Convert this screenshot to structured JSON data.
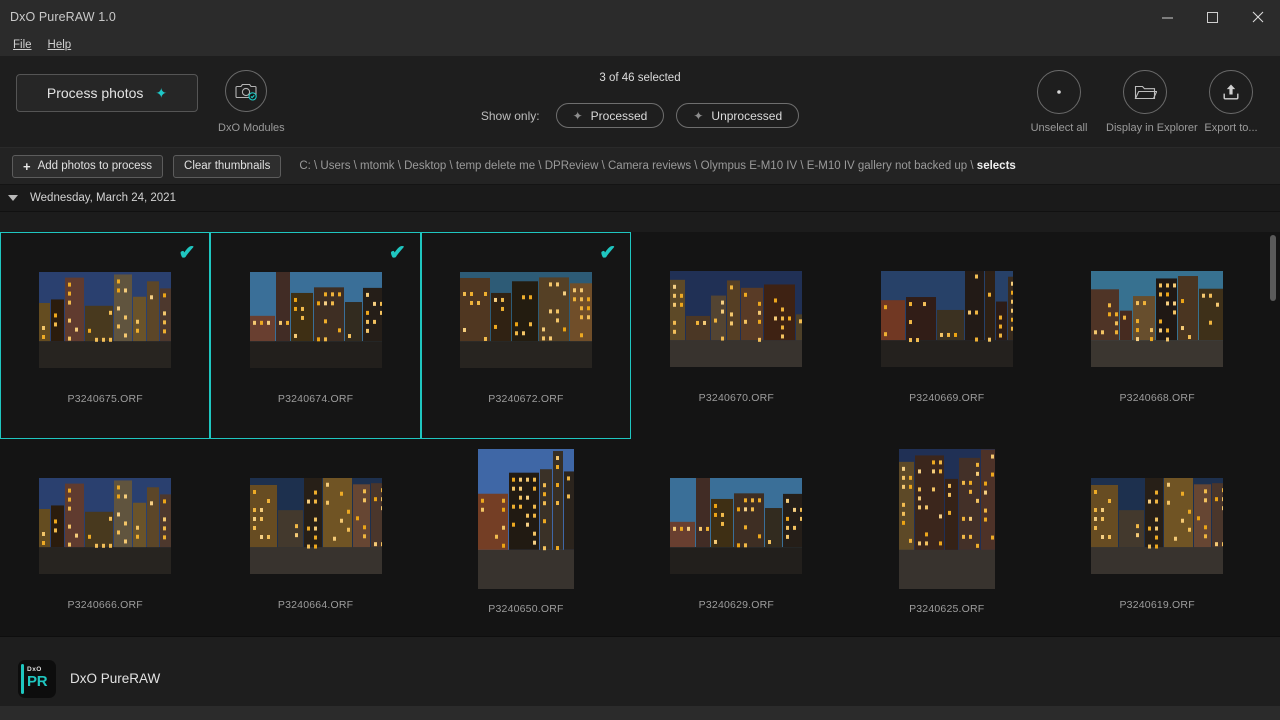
{
  "window": {
    "title": "DxO PureRAW 1.0",
    "controls": [
      {
        "name": "minimize",
        "glyph": "minimize-icon"
      },
      {
        "name": "maximize",
        "glyph": "maximize-icon"
      },
      {
        "name": "close",
        "glyph": "close-icon"
      }
    ]
  },
  "menubar": {
    "items": [
      {
        "label": "File",
        "accel": "F"
      },
      {
        "label": "Help",
        "accel": "H"
      }
    ]
  },
  "toolbar": {
    "process_label": "Process photos",
    "process_icon": "sparkle-icon",
    "modules_label": "DxO Modules",
    "modules_icon": "camera-check-icon",
    "selection_status": "3 of 46 selected",
    "show_only_label": "Show only:",
    "filters": [
      {
        "label": "Processed",
        "icon": "sparkle-icon",
        "active": false
      },
      {
        "label": "Unprocessed",
        "icon": "sparkle-icon",
        "active": false
      }
    ],
    "actions": [
      {
        "label": "Unselect all",
        "icon": "dot-circle-icon"
      },
      {
        "label": "Display in Explorer",
        "icon": "folder-icon"
      },
      {
        "label": "Export to...",
        "icon": "upload-icon"
      }
    ]
  },
  "subbar": {
    "add_photos_label": "Add photos to process",
    "add_photos_icon": "plus-icon",
    "clear_thumbnails_label": "Clear thumbnails",
    "path_prefix": "C: \\ Users \\ mtomk \\ Desktop \\ temp delete me \\ DPReview \\ Camera reviews \\ Olympus E-M10 IV \\ E-M10 IV gallery not backed up \\ ",
    "path_last": "selects"
  },
  "group": {
    "date_label": "Wednesday, March 24, 2021",
    "collapse_icon": "triangle-down-icon"
  },
  "grid": {
    "rows": [
      [
        {
          "filename": "P3240675.ORF",
          "selected": true,
          "orientation": "landscape"
        },
        {
          "filename": "P3240674.ORF",
          "selected": true,
          "orientation": "landscape"
        },
        {
          "filename": "P3240672.ORF",
          "selected": true,
          "orientation": "landscape"
        },
        {
          "filename": "P3240670.ORF",
          "selected": false,
          "orientation": "landscape"
        },
        {
          "filename": "P3240669.ORF",
          "selected": false,
          "orientation": "landscape"
        },
        {
          "filename": "P3240668.ORF",
          "selected": false,
          "orientation": "landscape"
        }
      ],
      [
        {
          "filename": "P3240666.ORF",
          "selected": false,
          "orientation": "landscape"
        },
        {
          "filename": "P3240664.ORF",
          "selected": false,
          "orientation": "landscape"
        },
        {
          "filename": "P3240650.ORF",
          "selected": false,
          "orientation": "portrait"
        },
        {
          "filename": "P3240629.ORF",
          "selected": false,
          "orientation": "landscape"
        },
        {
          "filename": "P3240625.ORF",
          "selected": false,
          "orientation": "portrait"
        },
        {
          "filename": "P3240619.ORF",
          "selected": false,
          "orientation": "landscape"
        }
      ]
    ],
    "check_glyph": "✔"
  },
  "footer": {
    "logo_top": "DxO",
    "logo_bottom": "PR",
    "app_name": "DxO PureRAW"
  },
  "colors": {
    "accent": "#1fc6c0",
    "window_bg": "#1c1c1c",
    "toolbar_bg": "#1e1e1e",
    "grid_bg": "#141414"
  }
}
